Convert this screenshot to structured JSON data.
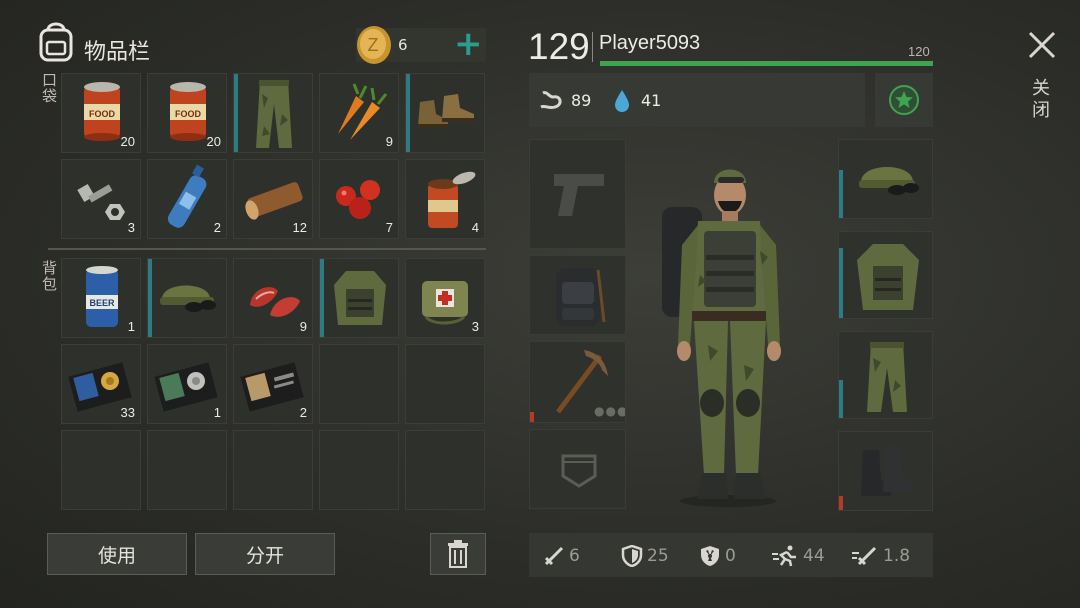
{
  "header": {
    "title": "物品栏",
    "coin_count": "6",
    "plus_label": "+"
  },
  "sections": {
    "pockets_label": "口袋",
    "backpack_label": "背包"
  },
  "pockets": [
    {
      "name": "food-can",
      "qty": "20"
    },
    {
      "name": "food-can",
      "qty": "20"
    },
    {
      "name": "camo-pants",
      "qty": ""
    },
    {
      "name": "carrots",
      "qty": "9"
    },
    {
      "name": "leather-boots",
      "qty": ""
    },
    {
      "name": "bolt-and-nut",
      "qty": "3"
    },
    {
      "name": "water-bottle",
      "qty": "2"
    },
    {
      "name": "wood-log",
      "qty": "12"
    },
    {
      "name": "berries",
      "qty": "7"
    },
    {
      "name": "open-can",
      "qty": "4"
    }
  ],
  "backpack": [
    {
      "name": "beer-can",
      "qty": "1"
    },
    {
      "name": "camo-cap",
      "qty": ""
    },
    {
      "name": "raw-meat",
      "qty": "9"
    },
    {
      "name": "camo-jacket",
      "qty": ""
    },
    {
      "name": "first-aid-bag",
      "qty": "3"
    },
    {
      "name": "police-badge-wallet",
      "qty": "33"
    },
    {
      "name": "id-wallet",
      "qty": "1"
    },
    {
      "name": "id-document",
      "qty": "2"
    }
  ],
  "buttons": {
    "use": "使用",
    "split": "分开",
    "delete_icon": "trash-icon"
  },
  "player": {
    "level": "129",
    "name": "Player5093",
    "max_xp": "120",
    "xp_progress": 1.0
  },
  "vitals": {
    "hunger": "89",
    "thirst": "41"
  },
  "close": {
    "label": "关闭",
    "icon": "close-icon"
  },
  "stats": {
    "attack": "6",
    "armor": "25",
    "radiation": "0",
    "speed": "44",
    "attack_speed": "1.8"
  },
  "colors": {
    "accent": "#3fa44f",
    "plus": "#2a9d8f",
    "durability": "#2e7b83",
    "warning": "#b63a2a"
  }
}
